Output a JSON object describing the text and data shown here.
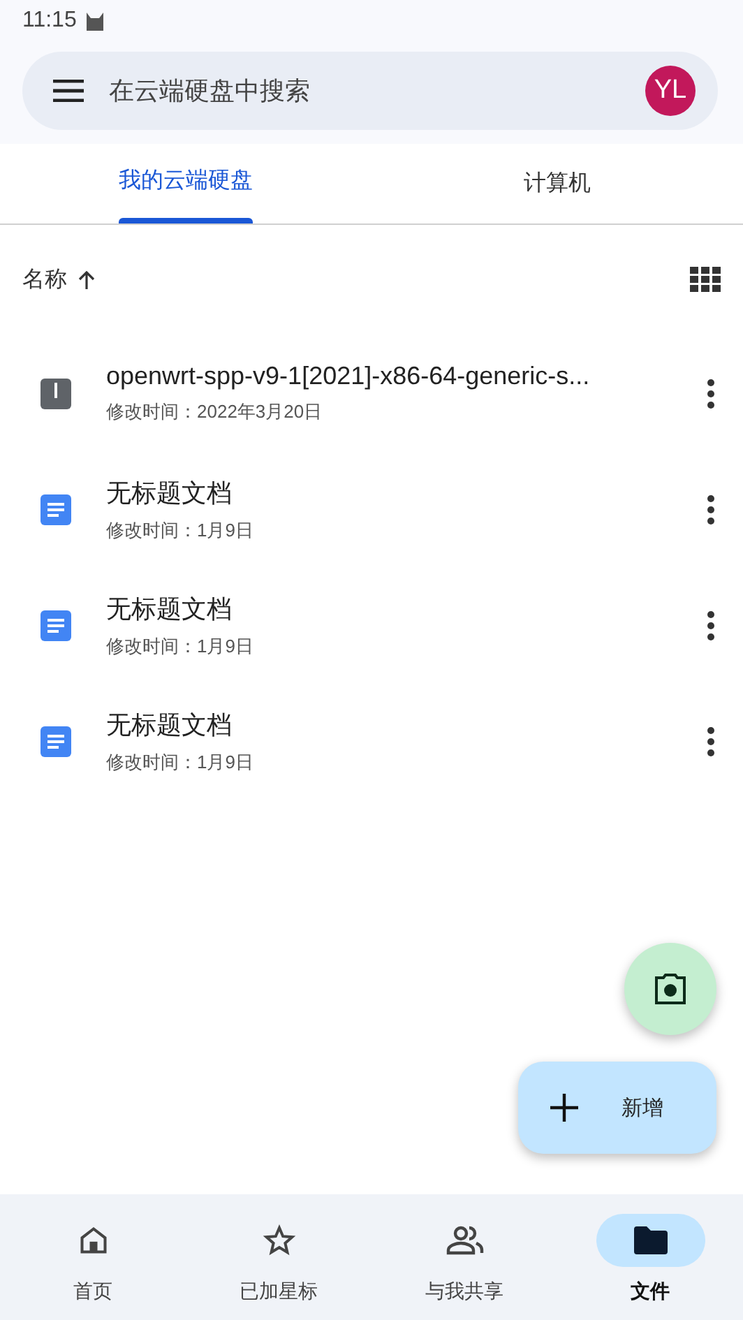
{
  "status_bar": {
    "time": "11:15"
  },
  "search": {
    "placeholder": "在云端硬盘中搜索",
    "avatar": "YL"
  },
  "tabs": [
    {
      "label": "我的云端硬盘",
      "selected": true
    },
    {
      "label": "计算机",
      "selected": false
    }
  ],
  "sort": {
    "label": "名称"
  },
  "files": [
    {
      "kind": "zip",
      "name": "openwrt-spp-v9-1[2021]-x86-64-generic-s...",
      "modified": "修改时间：2022年3月20日"
    },
    {
      "kind": "doc",
      "name": "无标题文档",
      "modified": "修改时间：1月9日"
    },
    {
      "kind": "doc",
      "name": "无标题文档",
      "modified": "修改时间：1月9日"
    },
    {
      "kind": "doc",
      "name": "无标题文档",
      "modified": "修改时间：1月9日"
    }
  ],
  "new_button": {
    "label": "新增"
  },
  "bottom_nav": [
    {
      "kind": "home",
      "label": "首页",
      "selected": false
    },
    {
      "kind": "star",
      "label": "已加星标",
      "selected": false
    },
    {
      "kind": "shared",
      "label": "与我共享",
      "selected": false
    },
    {
      "kind": "files",
      "label": "文件",
      "selected": true
    }
  ]
}
